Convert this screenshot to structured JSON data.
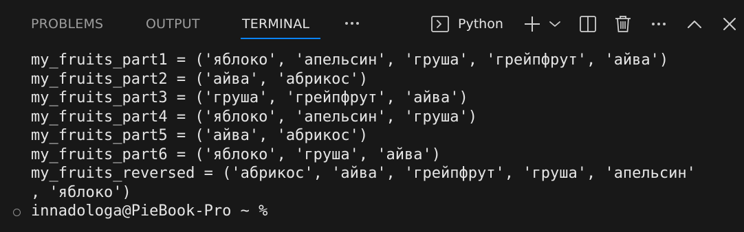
{
  "panel": {
    "tabs": [
      {
        "label": "PROBLEMS"
      },
      {
        "label": "OUTPUT"
      },
      {
        "label": "TERMINAL"
      }
    ],
    "active_tab": "TERMINAL",
    "shell_name": "Python",
    "icons": {
      "shell": "terminal-icon",
      "new_terminal": "plus-icon",
      "launch_profile": "chevron-down-icon",
      "split": "split-terminal-icon",
      "kill": "trash-icon",
      "more": "ellipsis-icon",
      "maximize": "chevron-up-icon",
      "close": "close-icon",
      "overflow": "ellipsis-icon"
    },
    "colors": {
      "background": "#181818",
      "accent": "#0a84ff",
      "text": "#e6e6e6",
      "muted_text": "#9d9d9d"
    }
  },
  "terminal": {
    "lines": [
      "my_fruits_part1 = ('яблоко', 'апельсин', 'груша', 'грейпфрут', 'айва')",
      "my_fruits_part2 = ('айва', 'абрикос')",
      "my_fruits_part3 = ('груша', 'грейпфрут', 'айва')",
      "my_fruits_part4 = ('яблоко', 'апельсин', 'груша')",
      "my_fruits_part5 = ('айва', 'абрикос')",
      "my_fruits_part6 = ('яблоко', 'груша', 'айва')",
      "my_fruits_reversed = ('абрикос', 'айва', 'грейпфрут', 'груша', 'апельсин'",
      ", 'яблоко')"
    ],
    "prompt": "innadologa@PieBook-Pro ~ %"
  }
}
